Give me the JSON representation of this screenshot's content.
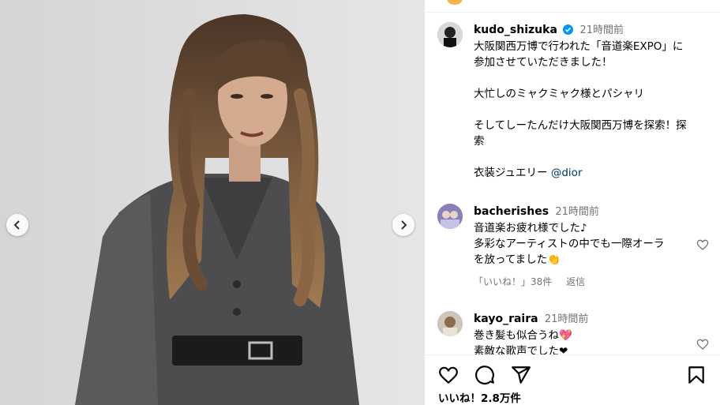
{
  "post": {
    "author": "kudo_shizuka",
    "time": "21時間前",
    "caption_lines": [
      "大阪関西万博で行われた「音道楽EXPO」に",
      "参加させていただきました！",
      "",
      "大忙しのミャクミャク様とパシャリ",
      "",
      "そしてしーたんだけ大阪関西万博を探索！探",
      "索",
      ""
    ],
    "caption_last_prefix": "衣装ジュエリー ",
    "caption_tag": "@dior"
  },
  "comments": [
    {
      "user": "bacherishes",
      "time": "21時間前",
      "lines": [
        "音道楽お疲れ様でした♪",
        "多彩なアーティストの中でも一際オーラ",
        "を放ってました👏"
      ],
      "likes": "「いいね！」38件",
      "reply": "返信"
    },
    {
      "user": "kayo_raira",
      "time": "21時間前",
      "lines": [
        "巻き髪も似合うね💖",
        "素敵な歌声でした❤"
      ]
    }
  ],
  "footer": {
    "likes": "いいね！2.8万件"
  },
  "icons": [
    "chevron-left-icon",
    "chevron-right-icon",
    "verified-icon",
    "heart-icon",
    "comment-icon",
    "share-icon",
    "bookmark-icon"
  ],
  "colors": {
    "verified": "#0095f6",
    "link": "#00376b",
    "muted": "#737373"
  }
}
